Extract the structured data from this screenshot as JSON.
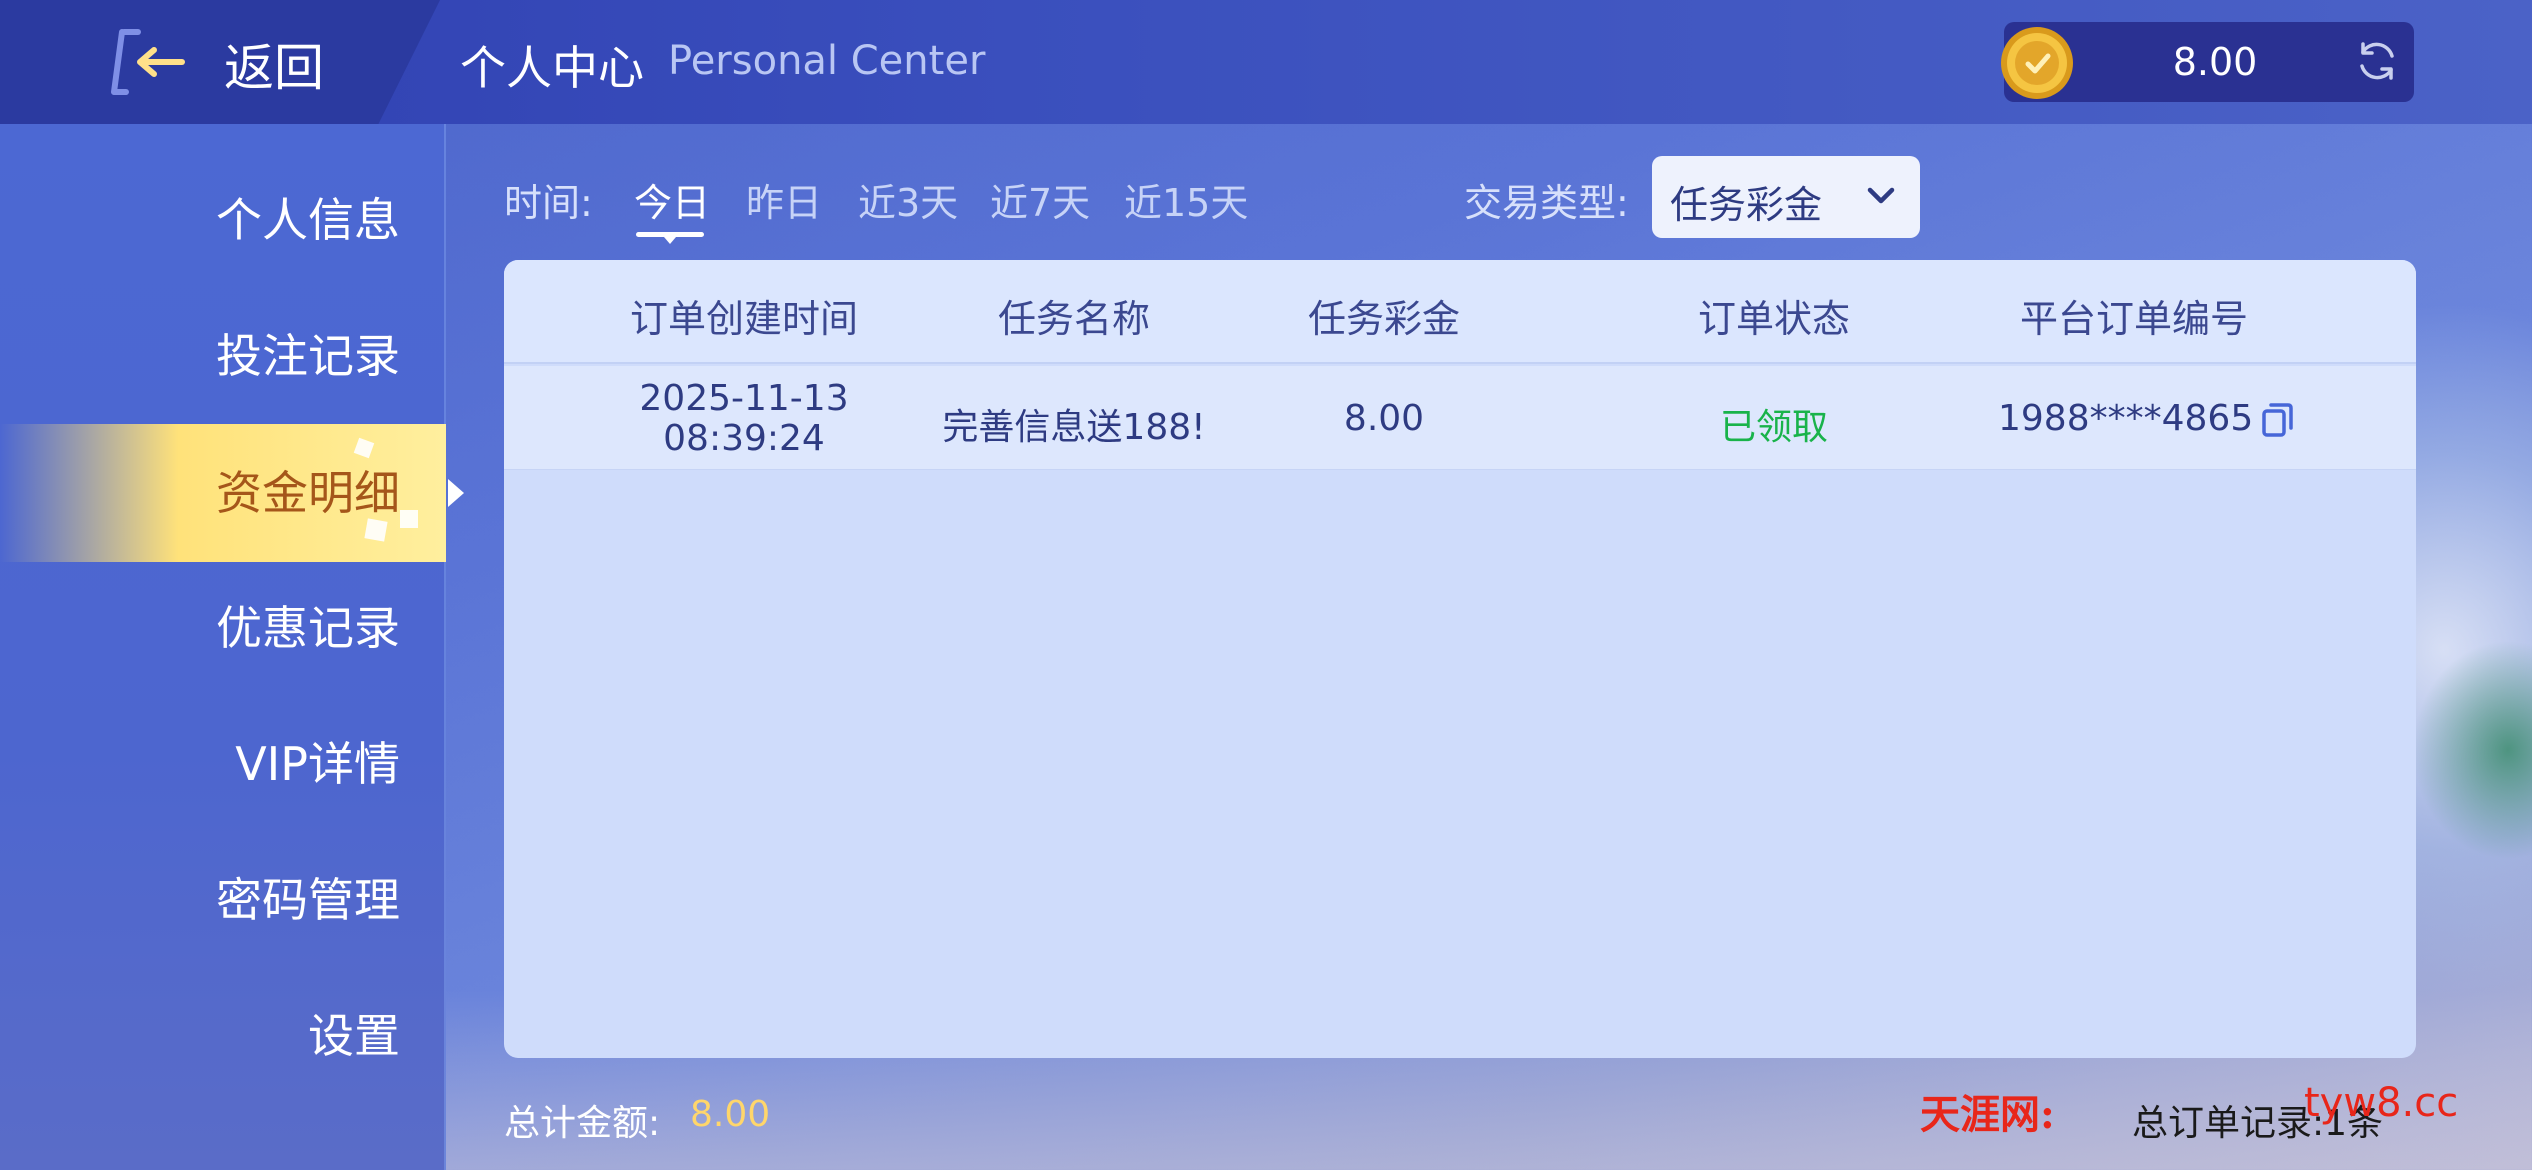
{
  "header": {
    "back_label": "返回",
    "title": "个人中心",
    "title_en": "Personal Center",
    "balance": "8.00"
  },
  "sidebar": {
    "items": [
      {
        "label": "个人信息"
      },
      {
        "label": "投注记录"
      },
      {
        "label": "资金明细",
        "active": true
      },
      {
        "label": "优惠记录"
      },
      {
        "label": "VIP详情"
      },
      {
        "label": "密码管理"
      },
      {
        "label": "设置"
      }
    ]
  },
  "filters": {
    "time_label": "时间:",
    "options": [
      "今日",
      "昨日",
      "近3天",
      "近7天",
      "近15天"
    ],
    "active_index": 0,
    "type_label": "交易类型:",
    "type_value": "任务彩金"
  },
  "table": {
    "headers": [
      "订单创建时间",
      "任务名称",
      "任务彩金",
      "订单状态",
      "平台订单编号"
    ],
    "rows": [
      {
        "date": "2025-11-13",
        "time": "08:39:24",
        "task": "完善信息送188!",
        "amount": "8.00",
        "status": "已领取",
        "order_no": "1988****4865"
      }
    ]
  },
  "footer": {
    "total_label": "总计金额:",
    "total_value": "8.00",
    "record_text": "总订单记录:1条"
  },
  "watermark": {
    "brand": "天涯网:",
    "url": "tyw8.cc"
  },
  "colors": {
    "accent_gold": "#ffd66b",
    "status_green": "#19b34a",
    "active_tab_text": "#a5561a",
    "watermark_red": "#e8261a"
  }
}
